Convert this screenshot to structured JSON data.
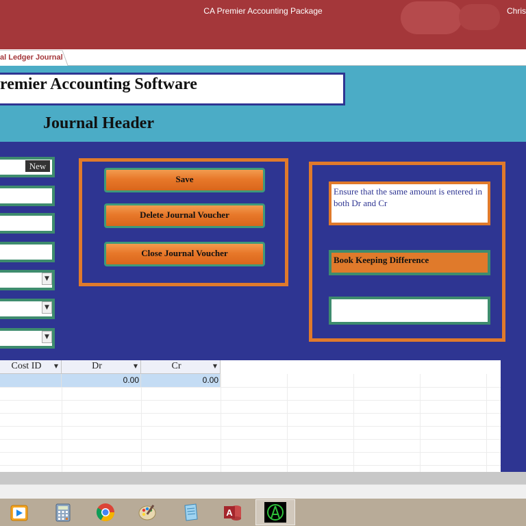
{
  "window": {
    "title": "CA Premier Accounting Package",
    "user": "Christ"
  },
  "tab": {
    "label": "al Ledger Journal"
  },
  "header": {
    "app_title": "remier Accounting Software",
    "section_title": "Journal Header"
  },
  "fields": {
    "new_label": "New"
  },
  "actions": {
    "save": "Save",
    "delete": "Delete Journal Voucher",
    "close": "Close Journal Voucher"
  },
  "info": {
    "note": "Ensure that the same amount is entered in both Dr and Cr",
    "difference_label": "Book Keeping Difference",
    "difference_value": ""
  },
  "grid": {
    "columns": [
      "Cost ID",
      "Dr",
      "Cr"
    ],
    "rows": [
      {
        "cost_id": "",
        "dr": "0.00",
        "cr": "0.00"
      }
    ]
  },
  "colors": {
    "titlebar": "#a4373a",
    "header_band": "#4bacc6",
    "form_bg": "#2e3592",
    "accent_orange": "#e07a2b",
    "accent_green": "#3e8c6e"
  },
  "taskbar": {
    "icons": [
      "media-player-icon",
      "calculator-icon",
      "chrome-icon",
      "paint-icon",
      "notepad-icon",
      "access-icon",
      "app-icon"
    ]
  }
}
